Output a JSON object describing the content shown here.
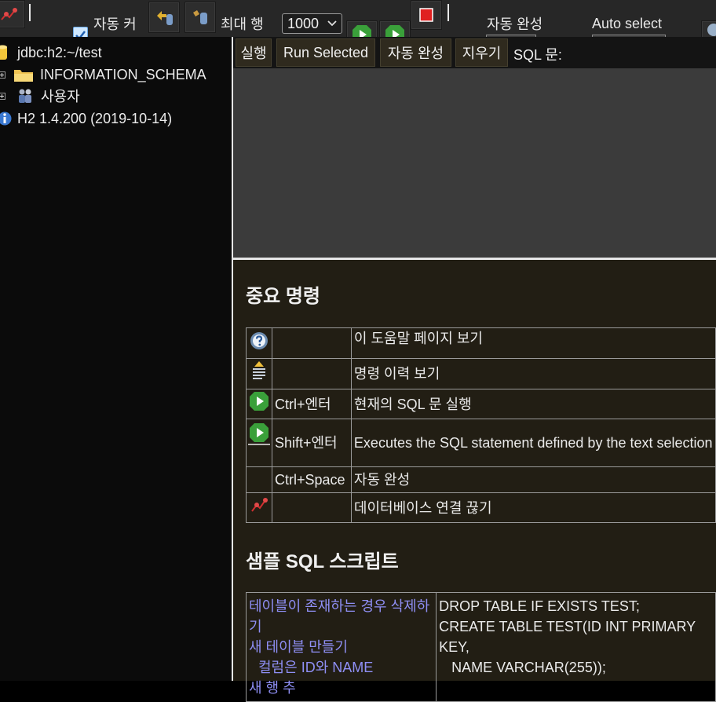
{
  "toolbar": {
    "auto_commit_label": "자동 커",
    "max_rows_label": "최대 행",
    "max_rows_value": "1000",
    "auto_complete_label": "자동 완성",
    "auto_select_label": "Auto select",
    "auto_commit_checked": true
  },
  "tree": {
    "connection": "jdbc:h2:~/test",
    "items": [
      {
        "label": "INFORMATION_SCHEMA",
        "icon": "folder-icon"
      },
      {
        "label": "사용자",
        "icon": "users-icon"
      }
    ],
    "version": "H2 1.4.200 (2019-10-14)"
  },
  "sql_bar": {
    "run": "실행",
    "run_selected": "Run Selected",
    "auto_complete": "자동 완성",
    "clear": "지우기",
    "sql_label": "SQL 문:"
  },
  "help": {
    "important_title": "중요 명령",
    "commands": [
      {
        "icon": "help-icon",
        "key": "",
        "desc": "이 도움말 페이지 보기"
      },
      {
        "icon": "history-icon",
        "key": "",
        "desc": "명령 이력 보기"
      },
      {
        "icon": "run-icon",
        "key": "Ctrl+엔터",
        "desc": "현재의 SQL 문 실행"
      },
      {
        "icon": "run-selected-icon",
        "key": "Shift+엔터",
        "desc": "Executes the SQL statement defined by the text selection"
      },
      {
        "icon": "",
        "key": "Ctrl+Space",
        "desc": "자동 완성"
      },
      {
        "icon": "disconnect-icon",
        "key": "",
        "desc": "데이터베이스 연결 끊기"
      }
    ],
    "samples_title": "샘플 SQL 스크립트",
    "samples": {
      "links": [
        "테이블이 존재하는 경우 삭제하기",
        "새 테이블 만들기",
        "컬럼은 ID와 NAME",
        "새 행 추"
      ],
      "column_prefix": "컬럼은 ",
      "column_id": "ID",
      "column_and": "와 ",
      "column_name": "NAME",
      "code": [
        "DROP TABLE IF EXISTS TEST;",
        "CREATE TABLE TEST(ID INT PRIMARY KEY,",
        "NAME VARCHAR(255));"
      ]
    }
  },
  "colors": {
    "toolbar_bg": "#272727",
    "results_bg": "#221e14",
    "link": "#8f8ff5"
  }
}
